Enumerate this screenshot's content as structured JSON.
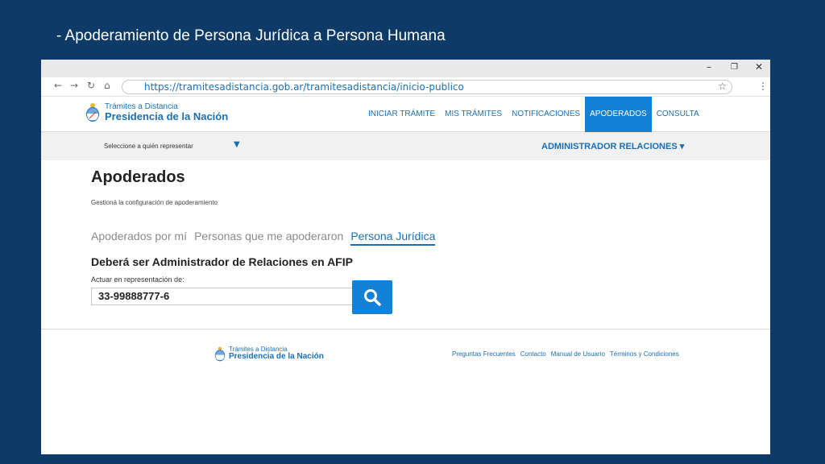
{
  "slide": {
    "title": "- Apoderamiento de Persona Jurídica a Persona Humana"
  },
  "window": {
    "minimize": "–",
    "restore": "❐",
    "close": "✕"
  },
  "browser": {
    "back": "←",
    "forward": "→",
    "reload": "↻",
    "home": "⌂",
    "url": "https://tramitesadistancia.gob.ar/tramitesadistancia/inicio-publico",
    "star": "☆",
    "menu": "⋮"
  },
  "site": {
    "logo_top": "Trámites a Distancia",
    "logo_bottom": "Presidencia de la Nación",
    "nav": [
      {
        "label": "INICIAR TRÁMITE",
        "active": false
      },
      {
        "label": "MIS TRÁMITES",
        "active": false
      },
      {
        "label": "NOTIFICACIONES",
        "active": false
      },
      {
        "label": "APODERADOS",
        "active": true
      },
      {
        "label": "CONSULTA",
        "active": false
      }
    ],
    "select_label": "Seleccione a quién representar",
    "select_arrow": "▼",
    "admin_menu": "ADMINISTRADOR RELACIONES ▾"
  },
  "main": {
    "title": "Apoderados",
    "subtitle": "Gestioná la configuración de apoderamiento",
    "tabs": [
      {
        "label": "Apoderados por mí",
        "active": false
      },
      {
        "label": "Personas que me apoderaron",
        "active": false
      },
      {
        "label": "Persona Jurídica",
        "active": true
      }
    ],
    "section_title": "Deberá ser Administrador de Relaciones en AFIP",
    "field_label": "Actuar en representación de:",
    "field_value": "33-99888777-6"
  },
  "footer": {
    "logo_top": "Trámites a Distancia",
    "logo_bottom": "Presidencia de la Nación",
    "links": [
      "Preguntas Frecuentes",
      "Contacto",
      "Manual de Usuario",
      "Términos y Condiciones"
    ]
  },
  "colors": {
    "slide_bg": "#0d3a66",
    "accent": "#1381d6",
    "link": "#1a6fb3"
  }
}
